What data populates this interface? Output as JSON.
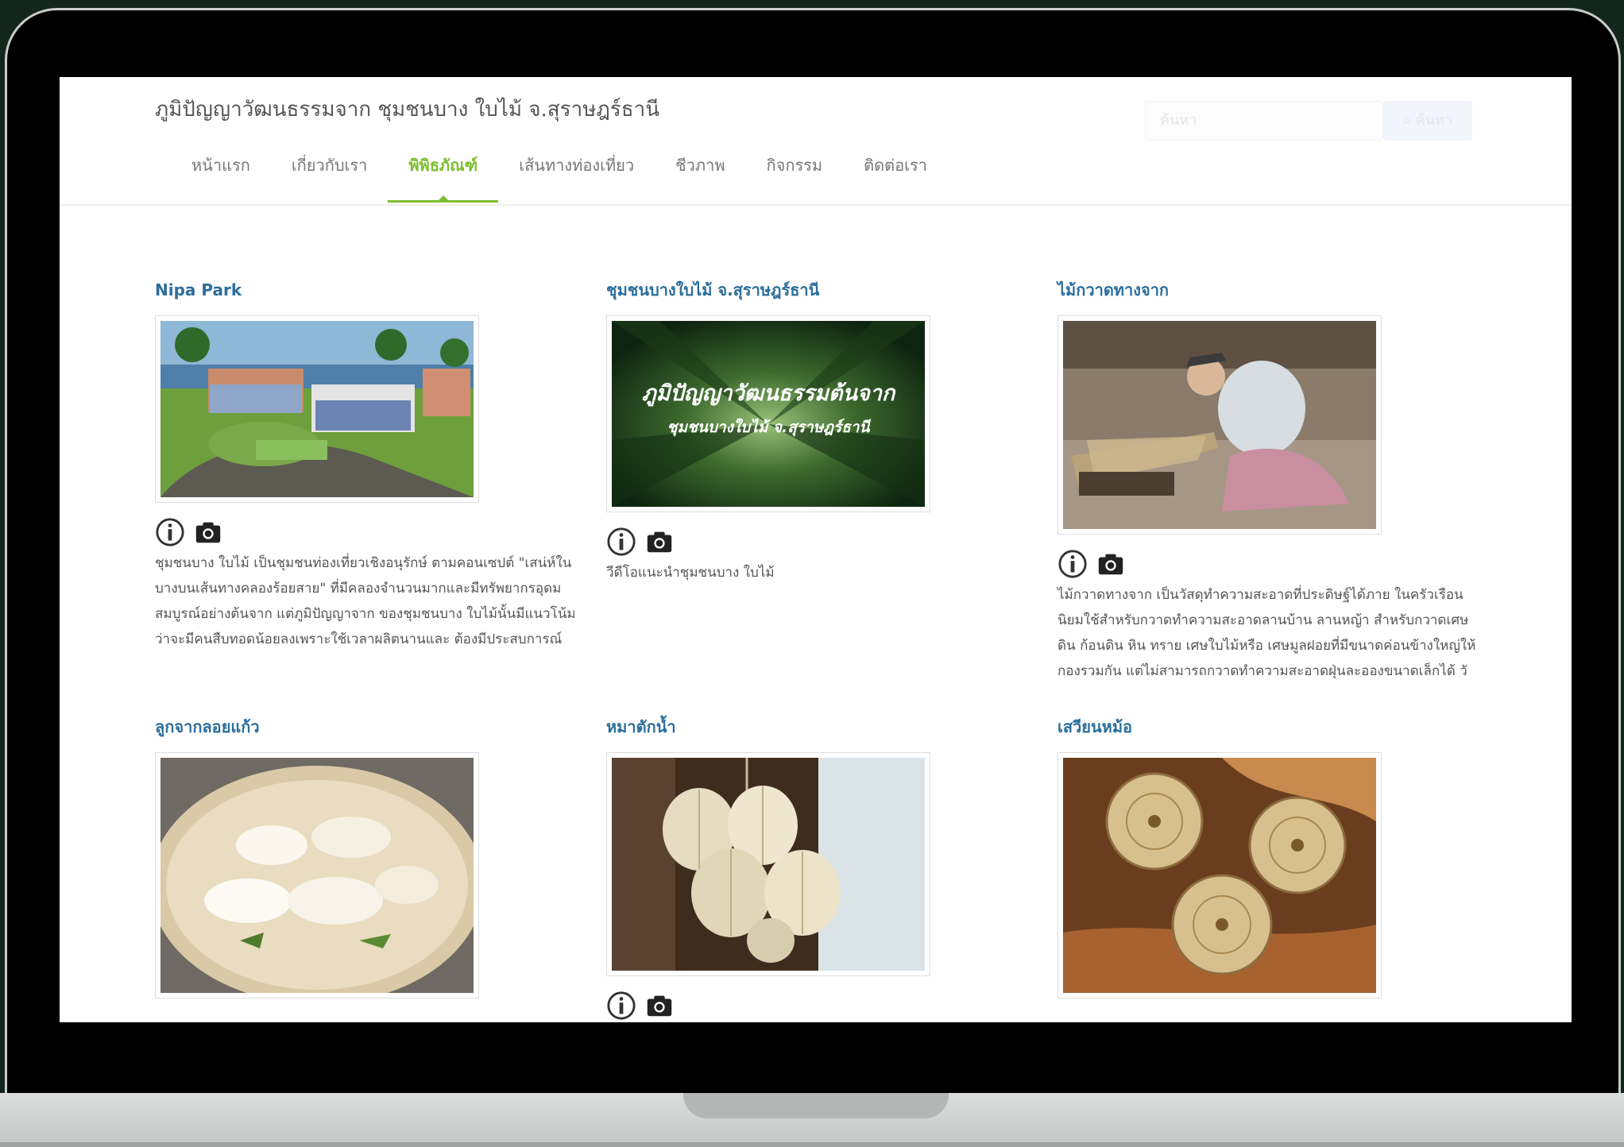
{
  "header": {
    "site_title": "ภูมิปัญญาวัฒนธรรมจาก ชุมชนบาง ใบไม้ จ.สุราษฎร์ธานี",
    "search_placeholder": "ค้นหา",
    "search_button": "ค้นหา"
  },
  "nav": {
    "items": [
      {
        "label": "หน้าแรก"
      },
      {
        "label": "เกี่ยวกับเรา"
      },
      {
        "label": "พิพิธภัณฑ์"
      },
      {
        "label": "เส้นทางท่องเที่ยว"
      },
      {
        "label": "ชีวภาพ"
      },
      {
        "label": "กิจกรรม"
      },
      {
        "label": "ติดต่อเรา"
      }
    ],
    "active": "พิพิธภัณฑ์"
  },
  "cards": [
    {
      "title": "Nipa Park",
      "image": "resort-aerial-render",
      "description": "ชุมชนบาง ใบไม้ เป็นชุมชนท่องเที่ยวเชิงอนุรักษ์ ตามคอนเซปต์ \"เสน่ห์ในบางบนเส้นทางคลองร้อยสาย\" ที่มีคลองจำนวนมากและมีทรัพยากรอุดมสมบูรณ์อย่างต้นจาก แต่ภูมิปัญญาจาก ของชุมชนบาง ใบไม้นั้นมีแนวโน้มว่าจะมีคนสืบทอดน้อยลงเพราะใช้เวลาผลิตนานและ ต้องมีประสบการณ์"
    },
    {
      "title": "ชุมชนบางใบไม้ จ.สุราษฎร์ธานี",
      "image": "palm-tunnel-banner",
      "image_text_line1": "ภูมิปัญญาวัฒนธรรมต้นจาก",
      "image_text_line2": "ชุมชนบางใบไม้ จ.สุราษฎร์ธานี",
      "description": "วีดีโอแนะนำชุมชนบาง ใบไม้"
    },
    {
      "title": "ไม้กวาดทางจาก",
      "image": "man-weaving-broom",
      "description": "ไม้กวาดทางจาก เป็นวัสดุทำความสะอาดที่ประดิษฐ์ได้ภาย ในครัวเรือน นิยมใช้สำหรับกวาดทำความสะอาดลานบ้าน ลานหญ้า สำหรับกวาดเศษดิน ก้อนดิน หิน ทราย เศษใบไม้หรือ เศษมูลฝอยที่มีขนาดค่อนข้างใหญ่ให้กองรวมกัน แต่ไม่สามารถกวาดทำความสะอาดฝุ่นละอองขนาดเล็กได้ วั"
    },
    {
      "title": "ลูกจากลอยแก้ว",
      "image": "palm-fruit-dessert",
      "description": ""
    },
    {
      "title": "หมาตักน้ำ",
      "image": "leaf-water-scoops",
      "description": ""
    },
    {
      "title": "เสวียนหม้อ",
      "image": "woven-pot-rings",
      "description": ""
    }
  ],
  "colors": {
    "accent_green": "#7cbf30",
    "link_blue": "#2b6e9c",
    "text_gray": "#555555",
    "frame_black": "#000000"
  }
}
